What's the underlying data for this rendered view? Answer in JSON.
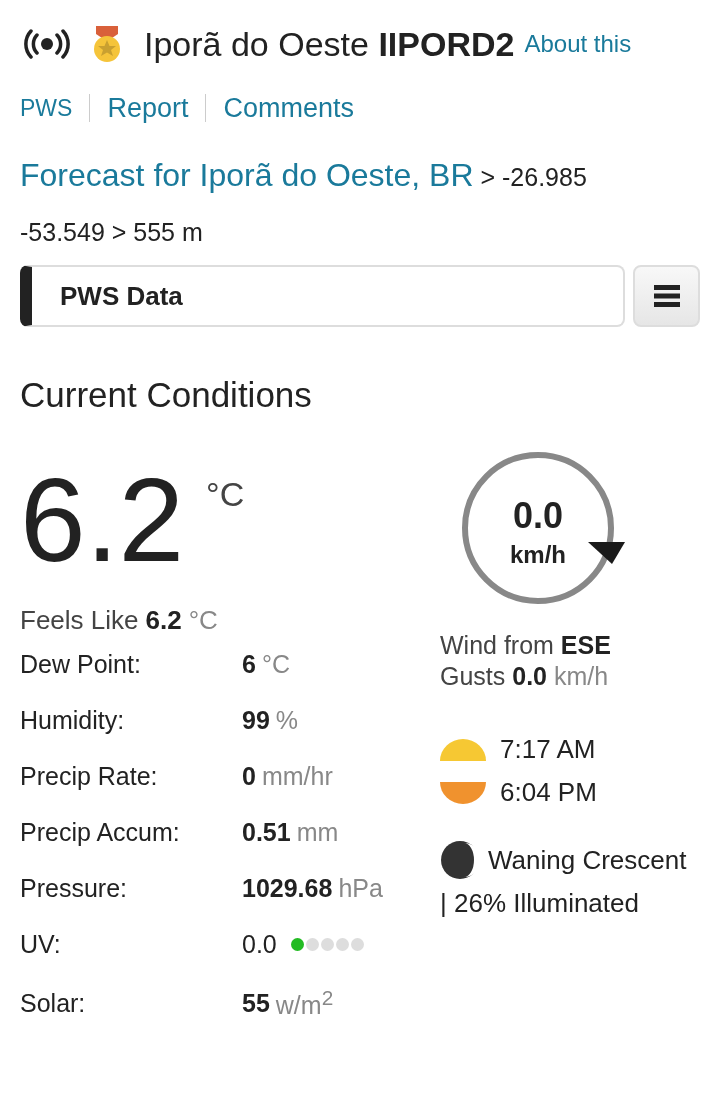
{
  "header": {
    "station_name": "Iporã do Oeste",
    "station_id": "IIPORD2",
    "about_link": "About this"
  },
  "nav_links": [
    "PWS",
    "Report",
    "Comments"
  ],
  "location": {
    "forecast_link": "Forecast for Iporã do Oeste, BR",
    "coords": "> -26.985 -53.549 > 555 m"
  },
  "section_select": {
    "label": "PWS Data"
  },
  "current": {
    "title": "Current Conditions",
    "temperature": "6.2",
    "temp_unit": "°C",
    "feels_like": {
      "label": "Feels Like",
      "value": "6.2",
      "unit": "°C"
    },
    "rows": [
      {
        "label": "Dew Point:",
        "value": "6",
        "unit": "°C",
        "kind": "plain"
      },
      {
        "label": "Humidity:",
        "value": "99",
        "unit": "%",
        "kind": "plain"
      },
      {
        "label": "Precip Rate:",
        "value": "0",
        "unit": "mm/hr",
        "kind": "plain"
      },
      {
        "label": "Precip Accum:",
        "value": "0.51",
        "unit": "mm",
        "kind": "plain"
      },
      {
        "label": "Pressure:",
        "value": "1029.68",
        "unit": "hPa",
        "kind": "plain"
      },
      {
        "label": "UV:",
        "value": "0.0",
        "kind": "uv",
        "dots": [
          {
            "color": "#22bb22"
          },
          {
            "color": "#dddddd"
          },
          {
            "color": "#dddddd"
          },
          {
            "color": "#dddddd"
          },
          {
            "color": "#dddddd"
          }
        ]
      },
      {
        "label": "Solar:",
        "value": "55",
        "unit": "w/m$^{2}$",
        "kind": "plain"
      }
    ],
    "wind": {
      "speed": "0.0",
      "unit": "km/h",
      "from_label": "Wind from",
      "direction": "ESE",
      "gusts_label": "Gusts",
      "gusts_value": "0.0",
      "gusts_unit": "km/h"
    },
    "sun": {
      "sunrise": "7:17 AM",
      "sunset": "6:04 PM"
    },
    "moon": {
      "phase": "Waning Crescent",
      "illumination": "| 26% Illuminated"
    }
  }
}
